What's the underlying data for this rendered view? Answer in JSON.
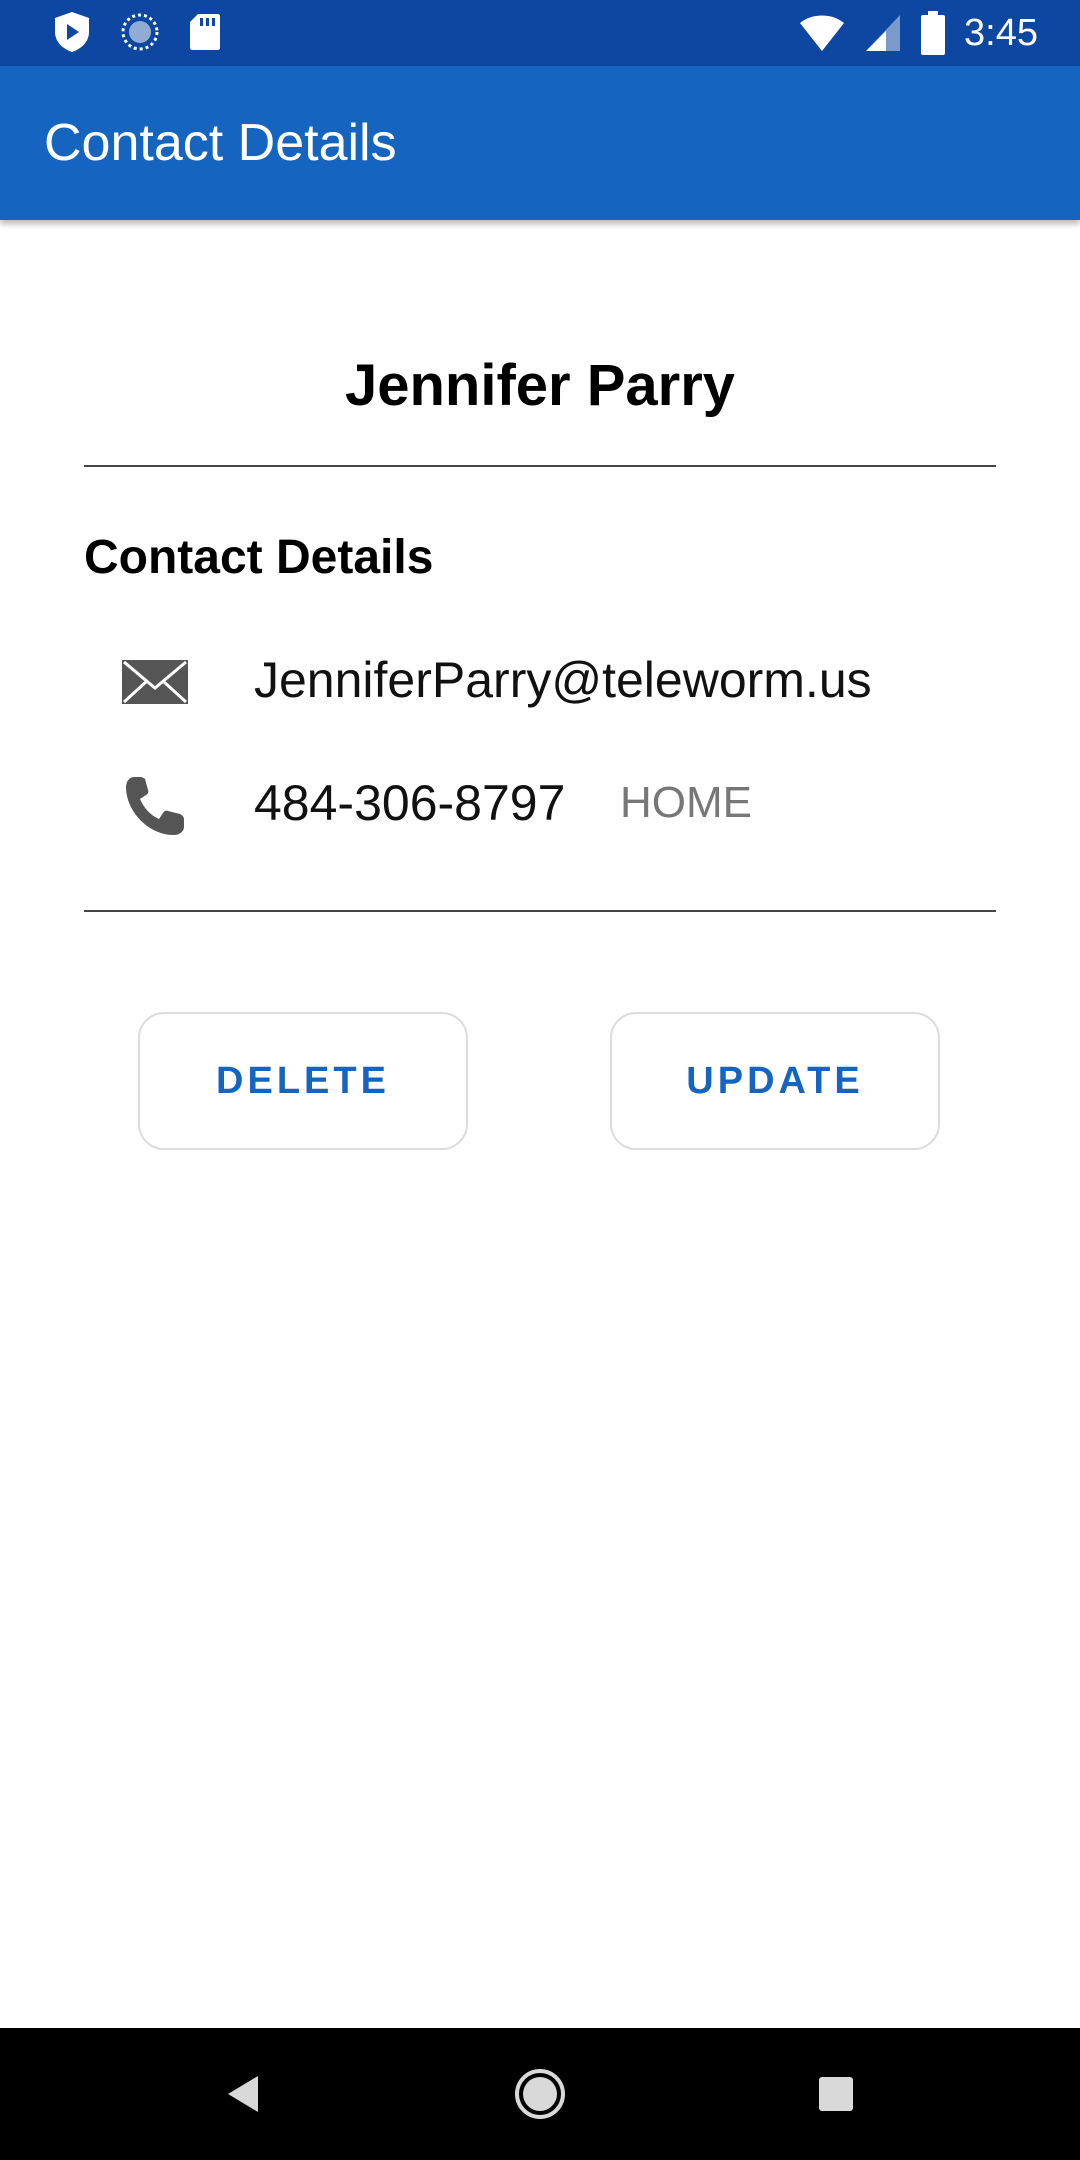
{
  "status_bar": {
    "time": "3:45",
    "left_icons": [
      "shield-icon",
      "sync-icon",
      "sd-card-icon"
    ],
    "right_icons": [
      "wifi-icon",
      "cell-signal-icon",
      "battery-icon"
    ]
  },
  "app_bar": {
    "title": "Contact Details"
  },
  "contact": {
    "name": "Jennifer Parry",
    "section_title": "Contact Details",
    "email": {
      "icon": "email-icon",
      "value": "JenniferParry@teleworm.us"
    },
    "phone": {
      "icon": "phone-icon",
      "value": "484-306-8797",
      "type": "HOME"
    }
  },
  "actions": {
    "delete_label": "DELETE",
    "update_label": "UPDATE"
  },
  "nav_bar": {
    "icons": [
      "back-icon",
      "home-icon",
      "recents-icon"
    ]
  },
  "colors": {
    "status_bar": "#0d47a1",
    "app_bar": "#1565c0",
    "button_text": "#1565c0",
    "phone_type": "#777777"
  }
}
